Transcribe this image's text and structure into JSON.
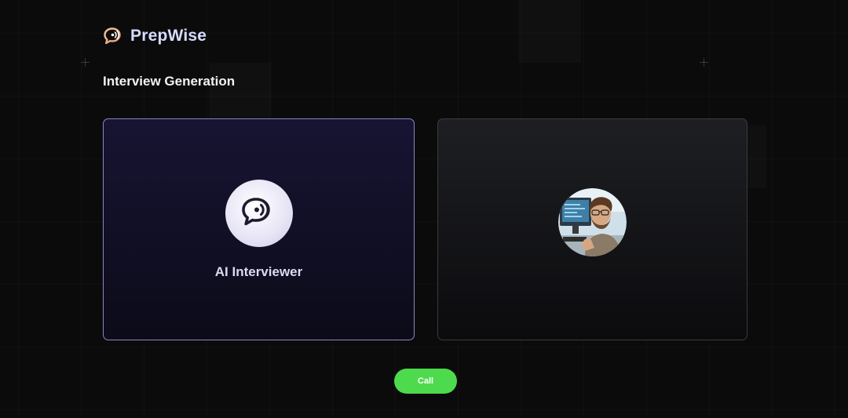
{
  "brand": {
    "name": "PrepWise",
    "icon": "chat-bubble-icon"
  },
  "page": {
    "title": "Interview Generation"
  },
  "ai_card": {
    "name": "AI Interviewer",
    "icon": "chat-bubble-icon"
  },
  "user_card": {
    "avatar": "user-avatar-photo"
  },
  "actions": {
    "call_label": "Call"
  },
  "colors": {
    "accent": "#4ddb4d",
    "brand_text": "#d6dcff",
    "ai_card_border": "#8c86c2",
    "background": "#0b0b0c"
  }
}
